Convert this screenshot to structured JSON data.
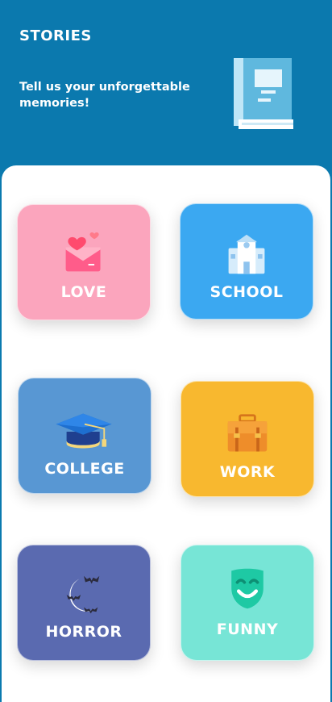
{
  "header": {
    "title": "STORIES",
    "subtitle": "Tell us your unforgettable memories!",
    "background": "#0b79ae",
    "icon": "book-icon"
  },
  "categories": [
    {
      "label": "LOVE",
      "color": "#fba5bd",
      "icon": "love-letter-icon"
    },
    {
      "label": "SCHOOL",
      "color": "#3ba8f1",
      "icon": "school-building-icon"
    },
    {
      "label": "COLLEGE",
      "color": "#5897d3",
      "icon": "graduation-cap-icon"
    },
    {
      "label": "WORK",
      "color": "#f8b82f",
      "icon": "briefcase-icon"
    },
    {
      "label": "HORROR",
      "color": "#5a6ab0",
      "icon": "moon-bats-icon"
    },
    {
      "label": "FUNNY",
      "color": "#77e5d6",
      "icon": "comedy-mask-icon"
    }
  ]
}
